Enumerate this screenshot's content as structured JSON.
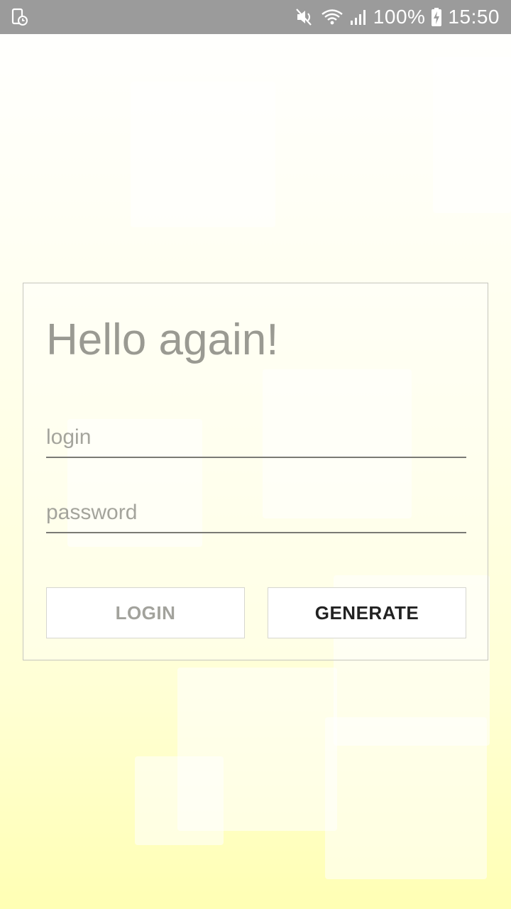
{
  "status_bar": {
    "battery": "100%",
    "time": "15:50",
    "icons": [
      "screen-lock-icon",
      "mute-icon",
      "wifi-icon",
      "signal-icon",
      "battery-charging-icon"
    ]
  },
  "login_card": {
    "title": "Hello again!",
    "login_field": {
      "value": "",
      "placeholder": "login"
    },
    "password_field": {
      "value": "",
      "placeholder": "password"
    },
    "login_button": "LOGIN",
    "generate_button": "GENERATE"
  },
  "colors": {
    "status_bar": "#9b9b9b",
    "background_top": "#ffffff",
    "background_bottom": "#ffffb4",
    "title_text": "#9a9a92",
    "disabled_button_text": "#a2a29c",
    "enabled_button_text": "#222222"
  }
}
